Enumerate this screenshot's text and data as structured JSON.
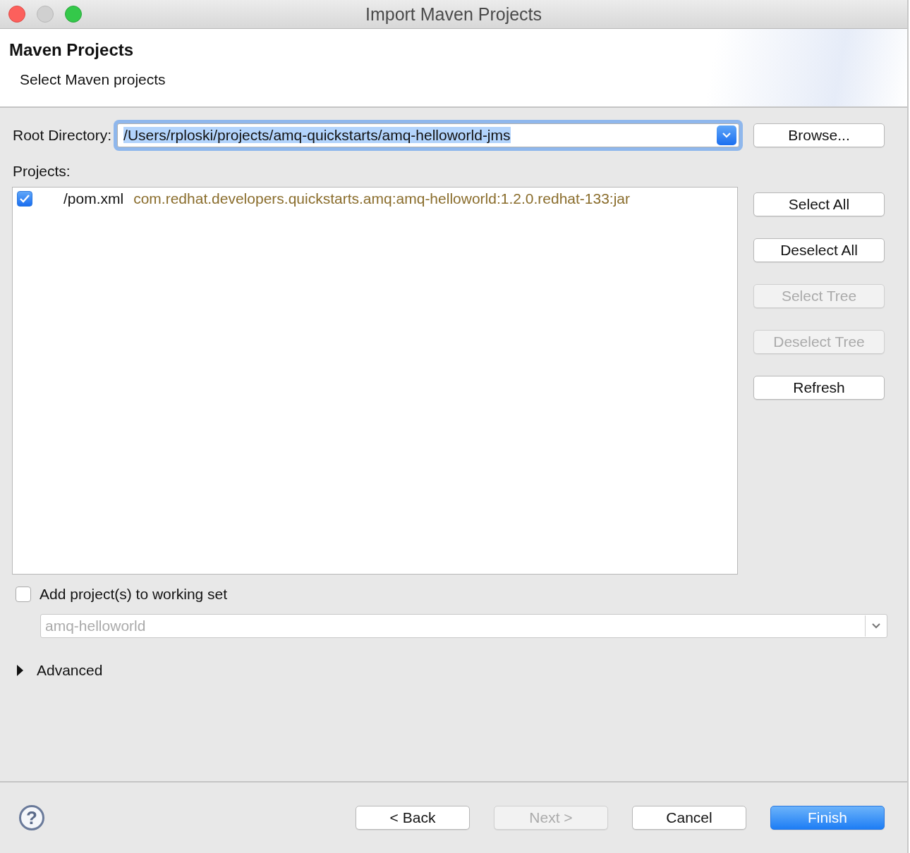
{
  "window": {
    "title": "Import Maven Projects"
  },
  "header": {
    "title": "Maven Projects",
    "subtitle": "Select Maven projects"
  },
  "root_directory": {
    "label": "Root Directory:",
    "value": "/Users/rploski/projects/amq-quickstarts/amq-helloworld-jms",
    "focused": true
  },
  "browse_button": {
    "label": "Browse...",
    "disabled": false
  },
  "projects": {
    "label": "Projects:",
    "items": [
      {
        "path": "/pom.xml",
        "artifact": "com.redhat.developers.quickstarts.amq:amq-helloworld:1.2.0.redhat-133:jar",
        "checked": true
      }
    ]
  },
  "side_buttons": [
    {
      "label": "Select All",
      "disabled": false
    },
    {
      "label": "Deselect All",
      "disabled": false
    },
    {
      "label": "Select Tree",
      "disabled": true
    },
    {
      "label": "Deselect Tree",
      "disabled": true
    },
    {
      "label": "Refresh",
      "disabled": false
    }
  ],
  "working_set": {
    "label": "Add project(s) to working set",
    "checked": false,
    "value": "amq-helloworld",
    "disabled": true
  },
  "advanced": {
    "label": "Advanced",
    "expanded": false
  },
  "footer": {
    "help_icon": "?",
    "buttons": [
      {
        "label": "< Back",
        "disabled": false,
        "default": false
      },
      {
        "label": "Next >",
        "disabled": true,
        "default": false
      },
      {
        "label": "Cancel",
        "disabled": false,
        "default": false
      },
      {
        "label": "Finish",
        "disabled": false,
        "default": true
      }
    ]
  }
}
